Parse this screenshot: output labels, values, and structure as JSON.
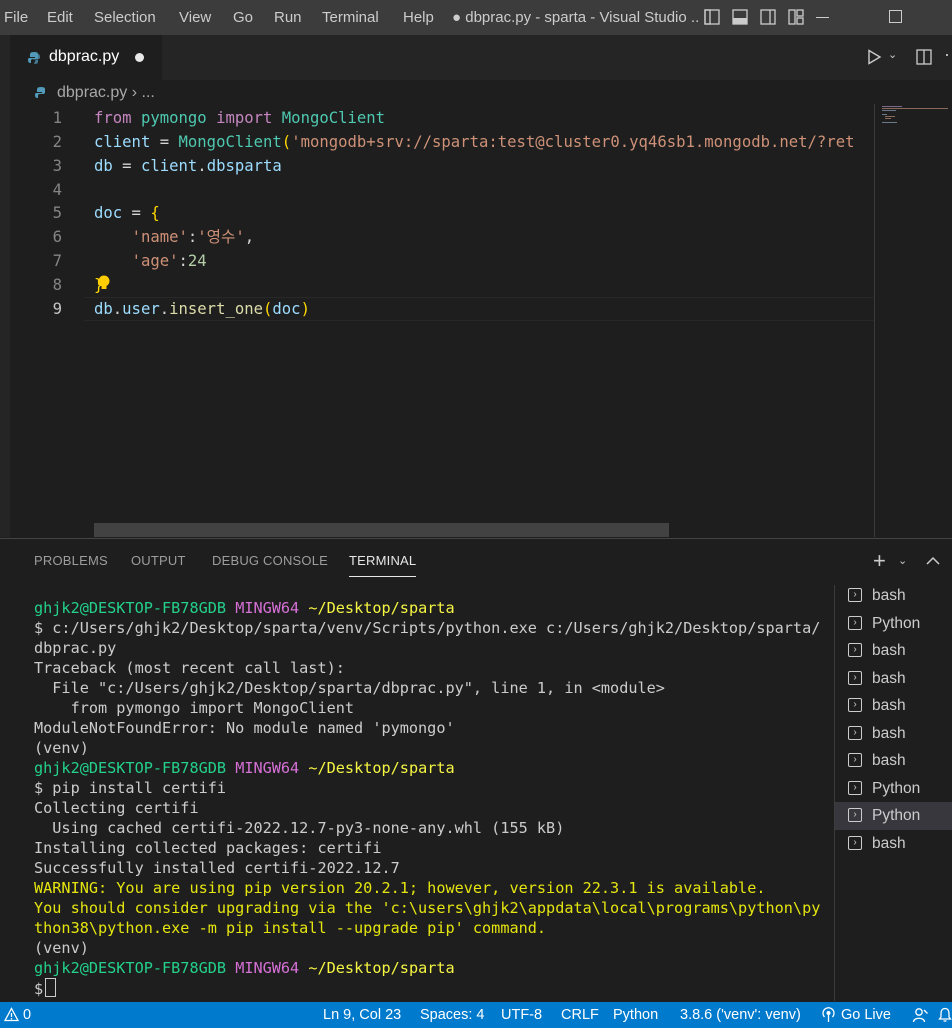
{
  "menu": [
    "File",
    "Edit",
    "Selection",
    "View",
    "Go",
    "Run",
    "Terminal",
    "Help"
  ],
  "window_title": "● dbprac.py - sparta - Visual Studio ...",
  "tab": {
    "label": "dbprac.py"
  },
  "breadcrumb": {
    "file": "dbprac.py",
    "sep": "›",
    "rest": "..."
  },
  "editor": {
    "line_numbers": [
      "1",
      "2",
      "3",
      "4",
      "5",
      "6",
      "7",
      "8",
      "9"
    ],
    "lines": [
      "from pymongo import MongoClient",
      "client = MongoClient('mongodb+srv://sparta:test@cluster0.yq46sb1.mongodb.net/?ret",
      "db = client.dbsparta",
      "",
      "doc = {",
      "    'name':'영수',",
      "    'age':24",
      "}",
      "db.user.insert_one(doc)"
    ]
  },
  "panel": {
    "tabs": [
      "PROBLEMS",
      "OUTPUT",
      "DEBUG CONSOLE",
      "TERMINAL"
    ],
    "active_tab": "TERMINAL"
  },
  "terminal": {
    "user": "ghjk2@DESKTOP-FB78GDB",
    "env": "MINGW64",
    "path": "~/Desktop/sparta",
    "cmd1": "$ c:/Users/ghjk2/Desktop/sparta/venv/Scripts/python.exe c:/Users/ghjk2/Desktop/sparta/",
    "cmd1b": "dbprac.py",
    "out1": [
      "Traceback (most recent call last):",
      "  File \"c:/Users/ghjk2/Desktop/sparta/dbprac.py\", line 1, in <module>",
      "    from pymongo import MongoClient",
      "ModuleNotFoundError: No module named 'pymongo'",
      "(venv)"
    ],
    "cmd2": "$ pip install certifi",
    "out2": [
      "Collecting certifi",
      "  Using cached certifi-2022.12.7-py3-none-any.whl (155 kB)",
      "Installing collected packages: certifi",
      "Successfully installed certifi-2022.12.7"
    ],
    "warn": [
      "WARNING: You are using pip version 20.2.1; however, version 22.3.1 is available.",
      "You should consider upgrading via the 'c:\\users\\ghjk2\\appdata\\local\\programs\\python\\py",
      "thon38\\python.exe -m pip install --upgrade pip' command."
    ],
    "venv2": "(venv)",
    "prompt": "$"
  },
  "terminal_list": [
    {
      "name": "bash",
      "selected": false
    },
    {
      "name": "Python",
      "selected": false
    },
    {
      "name": "bash",
      "selected": false
    },
    {
      "name": "bash",
      "selected": false
    },
    {
      "name": "bash",
      "selected": false
    },
    {
      "name": "bash",
      "selected": false
    },
    {
      "name": "bash",
      "selected": false
    },
    {
      "name": "Python",
      "selected": false
    },
    {
      "name": "Python",
      "selected": true
    },
    {
      "name": "bash",
      "selected": false
    }
  ],
  "status": {
    "problems": "0",
    "position": "Ln 9, Col 23",
    "spaces": "Spaces: 4",
    "encoding": "UTF-8",
    "eol": "CRLF",
    "language": "Python",
    "interpreter": "3.8.6 ('venv': venv)",
    "golive": "Go Live"
  },
  "colors": {
    "statusbar": "#007acc",
    "titlebar": "#3c3c3c",
    "editor_bg": "#1e1e1e"
  }
}
